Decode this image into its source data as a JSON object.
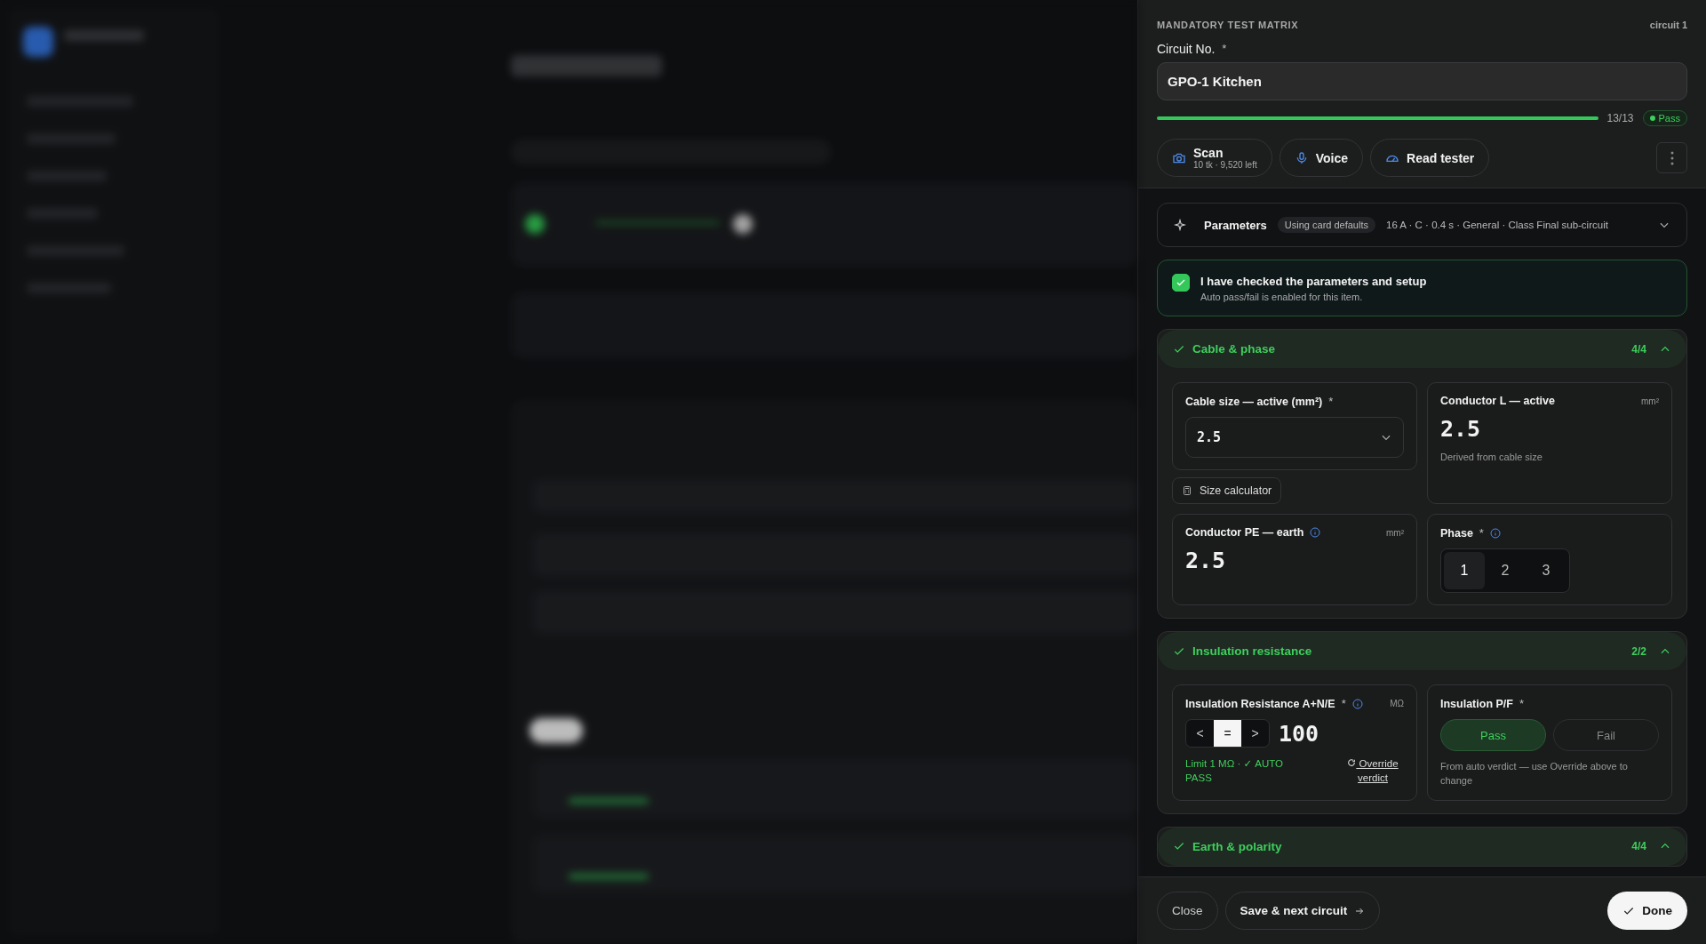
{
  "header": {
    "eyebrow": "MANDATORY TEST MATRIX",
    "circuit_tag": "circuit 1",
    "field_label": "Circuit No.",
    "required_mark": "*",
    "value": "GPO-1 Kitchen"
  },
  "progress": {
    "level": 1.0,
    "count": "13/13",
    "status": "Pass"
  },
  "actions": [
    {
      "kind": "scan",
      "label": "Scan",
      "sub": "10 tk · 9,520 left"
    },
    {
      "kind": "voice",
      "label": "Voice"
    },
    {
      "kind": "tester",
      "label": "Read tester"
    }
  ],
  "parameters": {
    "title": "Parameters",
    "badge": "Using card defaults",
    "summary": "16 A · C · 0.4 s · General · Class Final sub-circuit",
    "expanded": false
  },
  "confirm": {
    "checked": true,
    "title": "I have checked the parameters and setup",
    "note": "Auto pass/fail is enabled for this item."
  },
  "sections": [
    {
      "title": "Cable & phase",
      "count": "4/4",
      "complete": true,
      "expanded": true,
      "fields": [
        {
          "kind": "select",
          "label": "Cable size — active (mm²)",
          "required_mark": "*",
          "value": "2.5",
          "tool": "Size calculator"
        },
        {
          "kind": "readout",
          "label": "Conductor L — active",
          "unit": "mm²",
          "value": "2.5",
          "note": "Derived from cable size"
        },
        {
          "kind": "readout",
          "label": "Conductor PE — earth",
          "info": true,
          "unit": "mm²",
          "value": "2.5"
        },
        {
          "kind": "segmented",
          "label": "Phase",
          "required_mark": "*",
          "info": true,
          "options": [
            {
              "label": "1",
              "selected": true
            },
            {
              "label": "2",
              "selected": false
            },
            {
              "label": "3",
              "selected": false
            }
          ]
        }
      ]
    },
    {
      "title": "Insulation resistance",
      "count": "2/2",
      "complete": true,
      "expanded": true,
      "fields": [
        {
          "kind": "reading",
          "label": "Insulation Resistance A+N/E",
          "required_mark": "*",
          "info": true,
          "unit": "MΩ",
          "modes": [
            {
              "label": "<",
              "selected": false
            },
            {
              "label": "=",
              "selected": true
            },
            {
              "label": ">",
              "selected": false
            }
          ],
          "value": "100",
          "note": "Limit 1 MΩ · ✓ AUTO PASS",
          "link": "Override verdict"
        },
        {
          "kind": "verdict",
          "label": "Insulation P/F",
          "required_mark": "*",
          "options": [
            {
              "label": "Pass",
              "selected": true
            },
            {
              "label": "Fail",
              "selected": false
            }
          ],
          "note": "From auto verdict — use Override above to change"
        }
      ]
    },
    {
      "title": "Earth & polarity",
      "count": "4/4",
      "complete": true,
      "expanded": true
    }
  ],
  "footer": {
    "close": "Close",
    "next": "Save & next circuit",
    "done": "Done"
  }
}
